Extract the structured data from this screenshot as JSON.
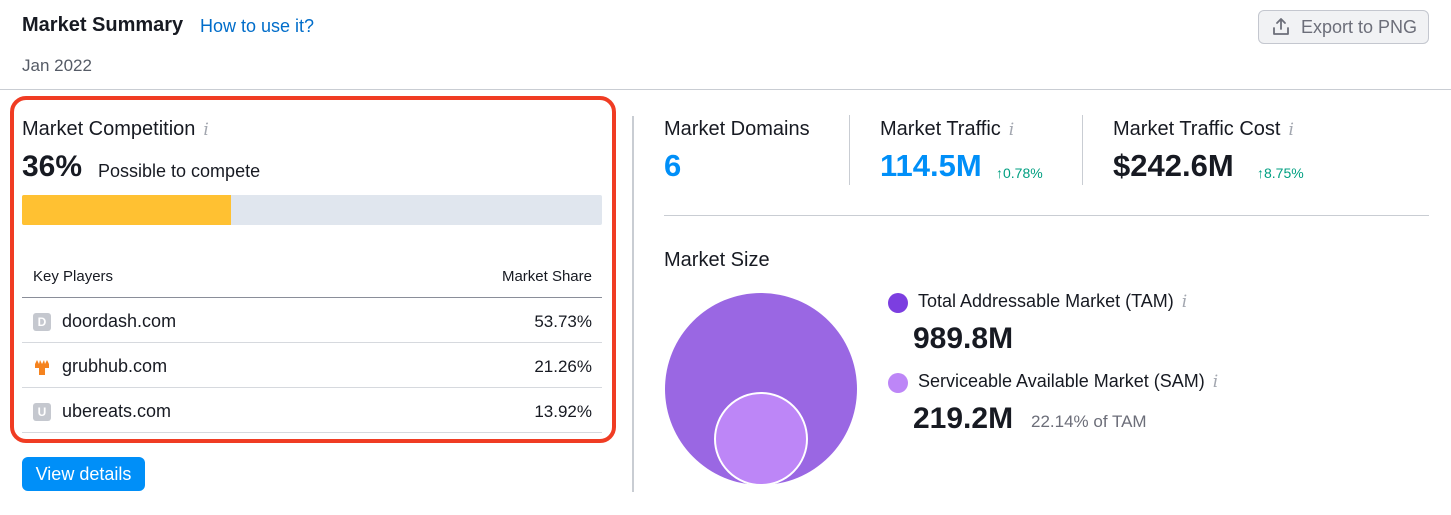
{
  "header": {
    "title": "Market Summary",
    "howto_link": "How to use it?",
    "date": "Jan 2022",
    "export_label": "Export to PNG"
  },
  "competition": {
    "title": "Market Competition",
    "percent": "36%",
    "percent_value": 0.36,
    "subtitle": "Possible to compete",
    "bar_color": "#ffc132",
    "table": {
      "col_players": "Key Players",
      "col_share": "Market Share",
      "rows": [
        {
          "favicon": "D",
          "domain": "doordash.com",
          "share": "53.73%"
        },
        {
          "favicon": "grubhub-icon",
          "domain": "grubhub.com",
          "share": "21.26%"
        },
        {
          "favicon": "U",
          "domain": "ubereats.com",
          "share": "13.92%"
        }
      ]
    },
    "view_details": "View details"
  },
  "metrics": {
    "domains": {
      "label": "Market Domains",
      "value": "6"
    },
    "traffic": {
      "label": "Market Traffic",
      "value": "114.5M",
      "delta": "0.78%"
    },
    "traffic_cost": {
      "label": "Market Traffic Cost",
      "value": "$242.6M",
      "delta": "8.75%"
    }
  },
  "market_size": {
    "title": "Market Size",
    "tam": {
      "label": "Total Addressable Market (TAM)",
      "value": "989.8M",
      "color": "#9a67e3"
    },
    "sam": {
      "label": "Serviceable Available Market (SAM)",
      "value": "219.2M",
      "note": "22.14% of TAM",
      "color": "#bd86f7"
    }
  },
  "colors": {
    "accent_blue": "#008ff8",
    "link_blue": "#006dca",
    "positive_green": "#009f81",
    "highlight_red": "#f03c23"
  }
}
